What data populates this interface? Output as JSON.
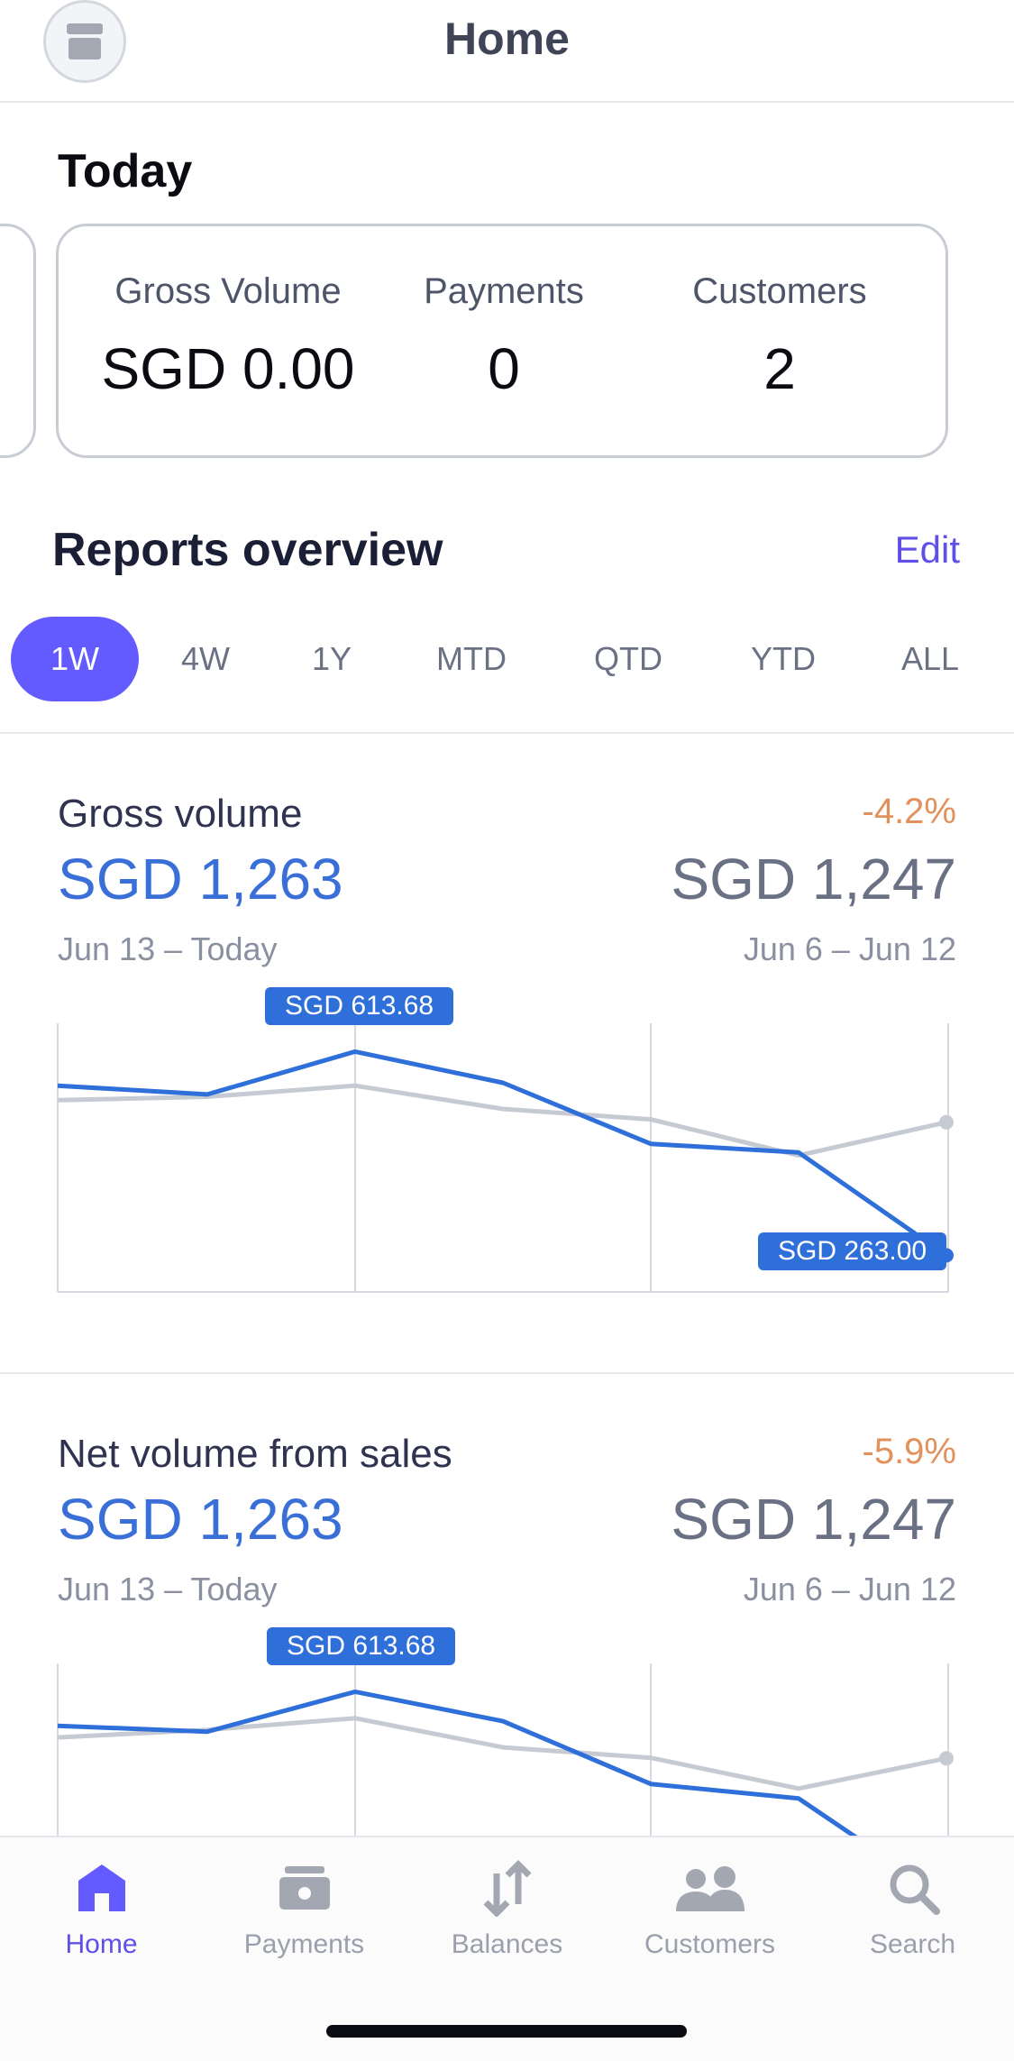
{
  "header": {
    "title": "Home",
    "avatar_icon": "storefront-icon"
  },
  "today": {
    "heading": "Today",
    "metrics": [
      {
        "label": "Gross Volume",
        "value": "SGD 0.00"
      },
      {
        "label": "Payments",
        "value": "0"
      },
      {
        "label": "Customers",
        "value": "2"
      }
    ]
  },
  "reports": {
    "heading": "Reports overview",
    "edit_label": "Edit",
    "ranges": [
      "1W",
      "4W",
      "1Y",
      "MTD",
      "QTD",
      "YTD",
      "ALL"
    ],
    "active_range": "1W",
    "cards": [
      {
        "title": "Gross volume",
        "change": "-4.2%",
        "current_value": "SGD 1,263",
        "previous_value": "SGD 1,247",
        "current_range": "Jun 13 – Today",
        "previous_range": "Jun 6 – Jun 12",
        "peak_label": "SGD 613.68",
        "end_label": "SGD 263.00"
      },
      {
        "title": "Net volume from sales",
        "change": "-5.9%",
        "current_value": "SGD 1,263",
        "previous_value": "SGD 1,247",
        "current_range": "Jun 13 – Today",
        "previous_range": "Jun 6 – Jun 12",
        "peak_label": "SGD 613.68"
      }
    ]
  },
  "chart_data": [
    {
      "type": "line",
      "x": [
        1,
        2,
        3,
        4,
        5,
        6,
        7
      ],
      "ylim": [
        200,
        650
      ],
      "series": [
        {
          "values": [
            555,
            540,
            613.68,
            560,
            455,
            440,
            263
          ],
          "color": "#2f6fd9"
        },
        {
          "values": [
            530,
            536,
            555,
            515,
            497,
            435,
            492
          ],
          "color": "#c6cad2"
        }
      ]
    },
    {
      "type": "line",
      "x": [
        1,
        2,
        3,
        4,
        5,
        6,
        7
      ],
      "ylim": [
        200,
        650
      ],
      "series": [
        {
          "values": [
            555,
            545,
            613.68,
            563,
            455,
            430,
            258
          ],
          "color": "#2f6fd9"
        },
        {
          "values": [
            535,
            548,
            568,
            518,
            500,
            447,
            499
          ],
          "color": "#c6cad2"
        }
      ]
    }
  ],
  "tabbar": {
    "items": [
      {
        "label": "Home",
        "icon": "home-icon",
        "active": true
      },
      {
        "label": "Payments",
        "icon": "wallet-icon",
        "active": false
      },
      {
        "label": "Balances",
        "icon": "transfer-arrows-icon",
        "active": false
      },
      {
        "label": "Customers",
        "icon": "people-icon",
        "active": false
      },
      {
        "label": "Search",
        "icon": "search-icon",
        "active": false
      }
    ],
    "active_color": "#635bff",
    "inactive_color": "#a3a7b1"
  }
}
